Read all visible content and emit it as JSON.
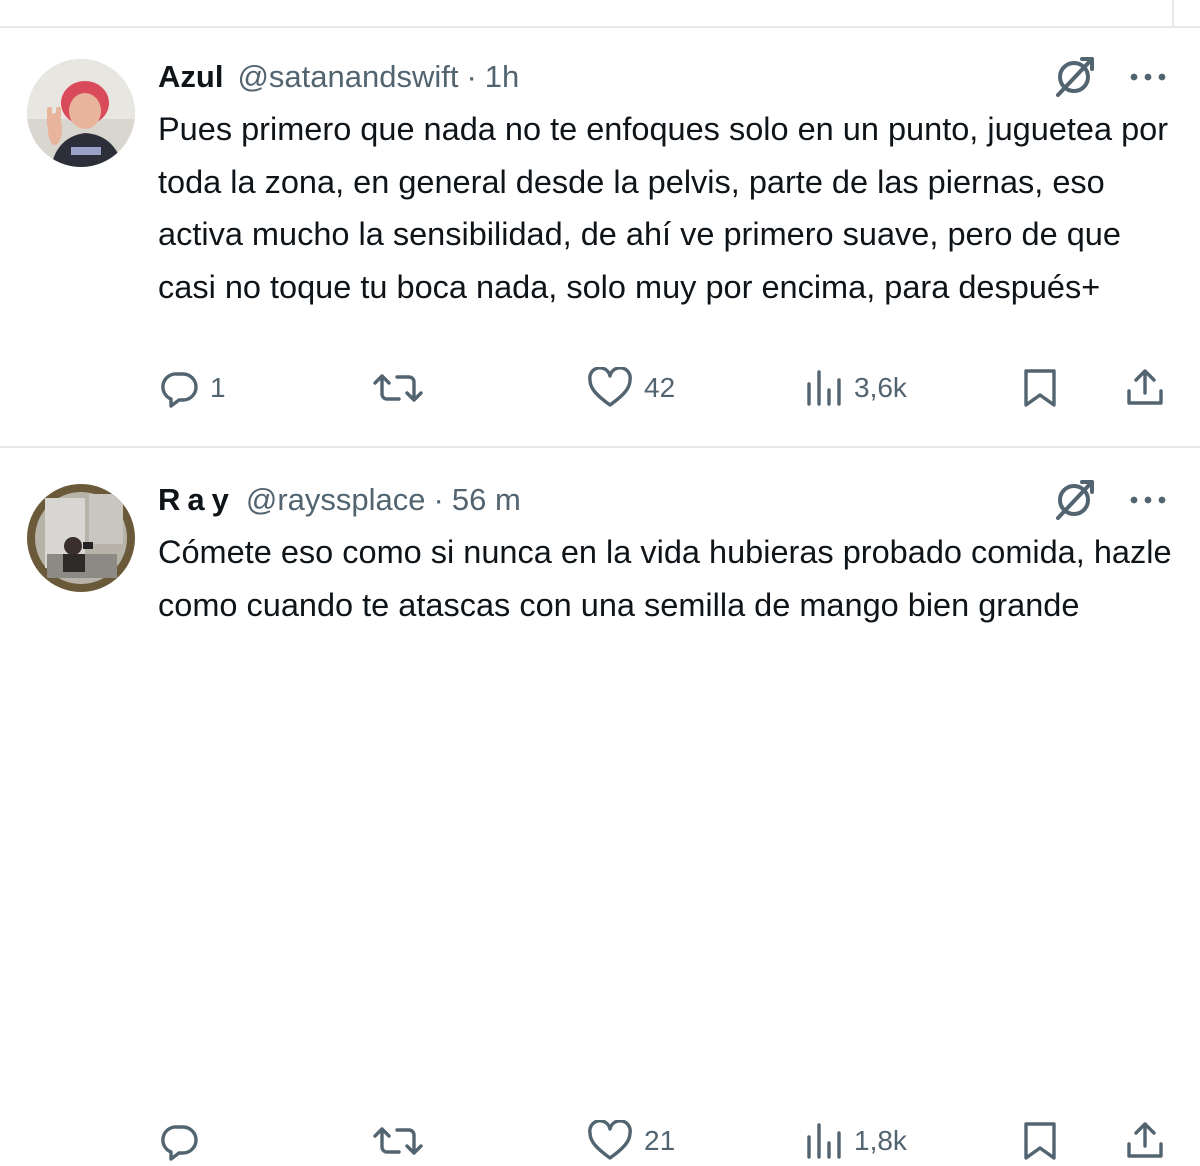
{
  "tweets": [
    {
      "name": "Azul",
      "handle": "@satanandswift",
      "separator": "·",
      "time": "1h",
      "text": "Pues primero que nada no te enfoques solo en un punto, juguetea por toda la zona, en general desde la pelvis, parte de las piernas, eso activa mucho la sensibilidad, de ahí ve primero suave, pero de que casi no toque tu boca nada, solo muy por encima, para después+",
      "replies": "1",
      "retweets": "",
      "likes": "42",
      "views": "3,6k"
    },
    {
      "name": "Ray",
      "handle": "@rayssplace",
      "separator": "·",
      "time": "56 m",
      "text": "Cómete eso como si nunca en la vida hubieras probado comida, hazle como cuando te atascas con una semilla de mango bien grande",
      "replies": "",
      "retweets": "",
      "likes": "21",
      "views": "1,8k"
    }
  ],
  "icons": {
    "grok": "grok-icon",
    "more": "more-icon",
    "reply": "reply-icon",
    "retweet": "retweet-icon",
    "like": "heart-icon",
    "views": "views-icon",
    "bookmark": "bookmark-icon",
    "share": "share-icon"
  },
  "colors": {
    "text": "#0f1419",
    "secondary": "#536471",
    "divider": "#e6e9ec"
  }
}
